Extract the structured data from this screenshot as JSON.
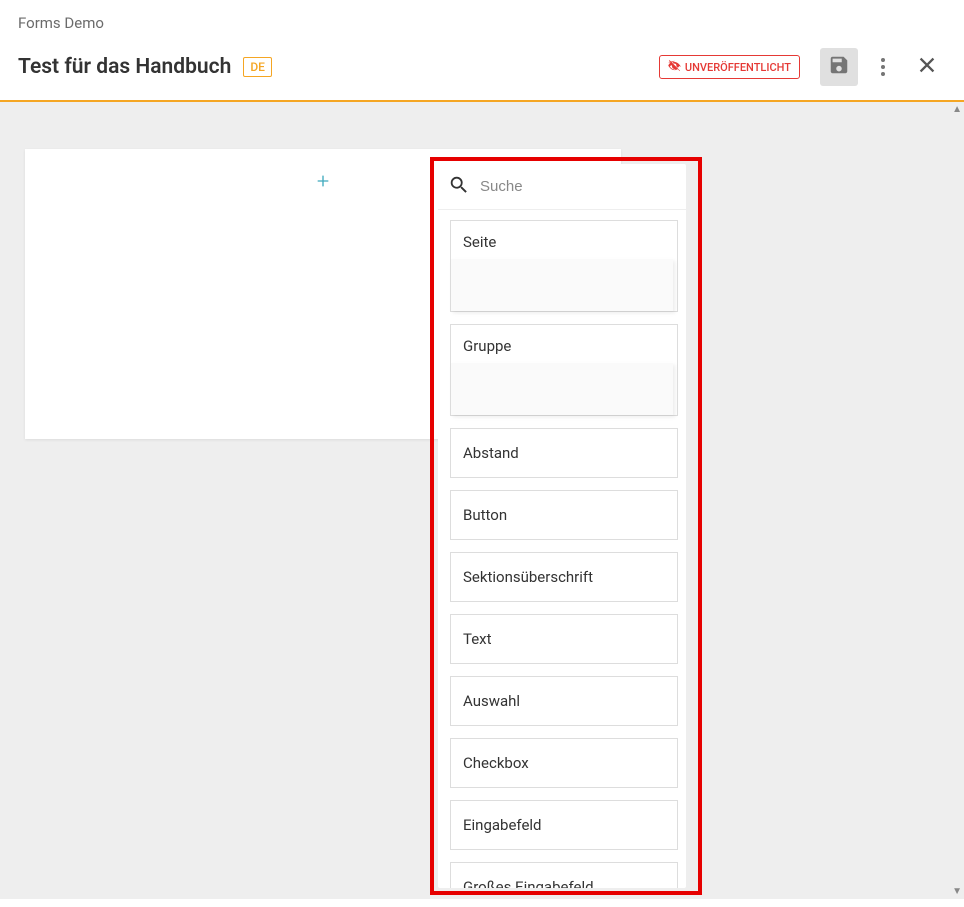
{
  "breadcrumb": "Forms Demo",
  "header": {
    "title": "Test für das Handbuch",
    "lang": "DE",
    "status": "UNVERÖFFENTLICHT"
  },
  "popover": {
    "search_placeholder": "Suche",
    "items": [
      {
        "label": "Seite",
        "tall": true
      },
      {
        "label": "Gruppe",
        "tall": true
      },
      {
        "label": "Abstand",
        "tall": false
      },
      {
        "label": "Button",
        "tall": false
      },
      {
        "label": "Sektionsüberschrift",
        "tall": false
      },
      {
        "label": "Text",
        "tall": false
      },
      {
        "label": "Auswahl",
        "tall": false
      },
      {
        "label": "Checkbox",
        "tall": false
      },
      {
        "label": "Eingabefeld",
        "tall": false
      },
      {
        "label": "Großes Eingabefeld",
        "tall": false
      }
    ]
  }
}
